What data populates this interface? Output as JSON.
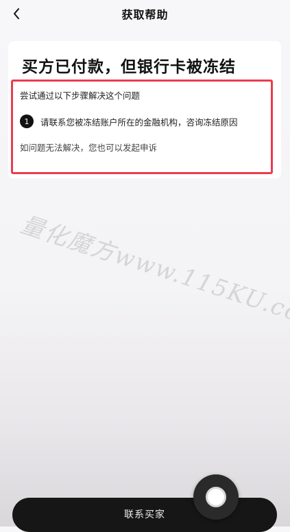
{
  "header": {
    "title": "获取帮助",
    "back_icon": "chevron-left-icon"
  },
  "card": {
    "title": "买方已付款，但银行卡被冻结"
  },
  "highlight": {
    "color": "#ea3b4e",
    "hint": "尝试通过以下步骤解决这个问题",
    "steps": [
      {
        "number": "1",
        "text": "请联系您被冻结账户所在的金融机构，咨询冻结原因"
      }
    ],
    "appeal_text": "如问题无法解决，您也可以发起申诉"
  },
  "watermark": "量化魔方www.115KU.com",
  "footer": {
    "contact_label": "联系买家"
  },
  "floating_button": {
    "icon": "record-circle-icon"
  }
}
